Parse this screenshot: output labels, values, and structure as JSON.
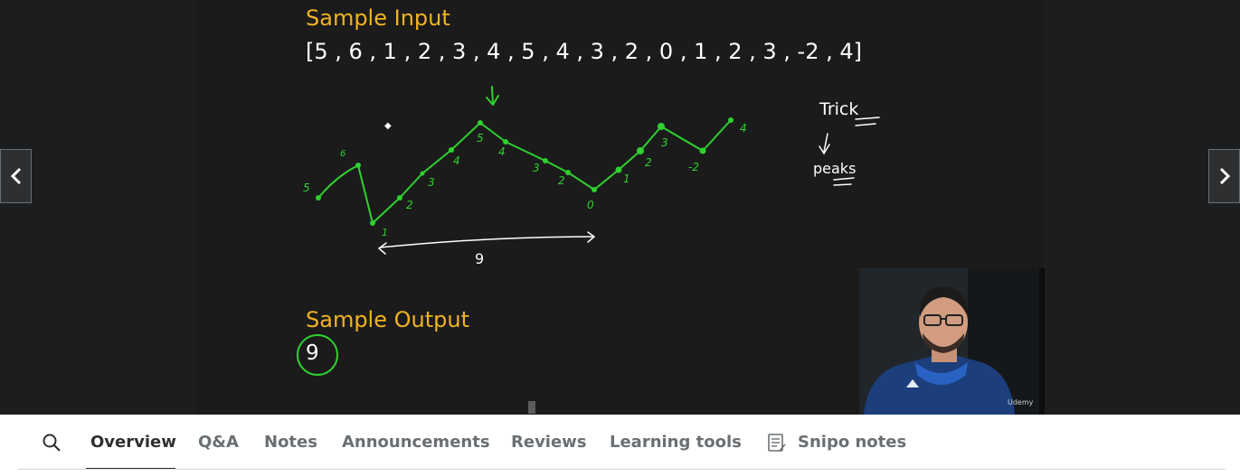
{
  "slide": {
    "input_heading": "Sample Input",
    "input_array": "[5 , 6 , 1 , 2 , 3 , 4 , 5 , 4 , 3 , 2 , 0 , 1 , 2 , 3 , -2 , 4]",
    "output_heading": "Sample Output",
    "output_value": "9"
  },
  "annotations": {
    "trick": "Trick",
    "peaks": "peaks",
    "span_label": "9",
    "point_labels": [
      "5",
      "6",
      "1",
      "2",
      "3",
      "4",
      "5",
      "4",
      "3",
      "2",
      "0",
      "1",
      "2",
      "3",
      "-2",
      "4"
    ]
  },
  "video": {
    "prev_icon": "chevron-left-icon",
    "next_icon": "chevron-right-icon",
    "watermark": "Udemy"
  },
  "tabs": {
    "search_icon": "search-icon",
    "items": [
      {
        "label": "Overview",
        "active": true
      },
      {
        "label": "Q&A",
        "active": false
      },
      {
        "label": "Notes",
        "active": false
      },
      {
        "label": "Announcements",
        "active": false
      },
      {
        "label": "Reviews",
        "active": false
      },
      {
        "label": "Learning tools",
        "active": false
      },
      {
        "label": "Snipo notes",
        "active": false,
        "icon": "notes-icon"
      }
    ]
  },
  "colors": {
    "heading": "#f0b323",
    "ink_green": "#2fd12f",
    "player_bg": "#1c1d1f",
    "active_tab": "#2d2f31",
    "inactive_tab": "#6a6f73"
  }
}
